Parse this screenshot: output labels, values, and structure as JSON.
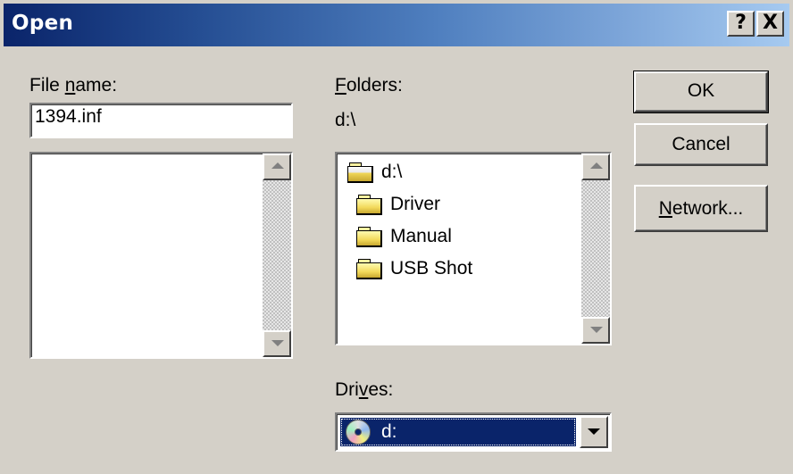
{
  "window": {
    "title": "Open",
    "help_label": "?",
    "close_label": "X"
  },
  "file": {
    "label_pre": "File ",
    "label_accel": "n",
    "label_post": "ame:",
    "value": "1394.inf",
    "items": []
  },
  "folders": {
    "label_accel": "F",
    "label_post": "olders:",
    "current_path": "d:\\",
    "items": [
      {
        "name": "d:\\",
        "icon": "open-folder-icon"
      },
      {
        "name": "Driver",
        "icon": "folder-icon"
      },
      {
        "name": "Manual",
        "icon": "folder-icon"
      },
      {
        "name": "USB Shot",
        "icon": "folder-icon"
      }
    ]
  },
  "drives": {
    "label_pre": "Dri",
    "label_accel": "v",
    "label_post": "es:",
    "selected": "d:",
    "icon": "cd-drive-icon"
  },
  "buttons": {
    "ok": "OK",
    "cancel": "Cancel",
    "network_accel": "N",
    "network_post": "etwork..."
  },
  "colors": {
    "title_start": "#0a246a",
    "title_end": "#a6caf0",
    "face": "#d4d0c8",
    "selection": "#0a246a"
  }
}
